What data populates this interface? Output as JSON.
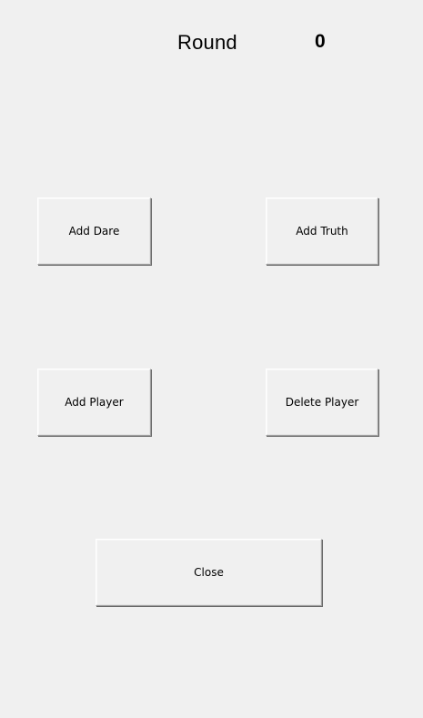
{
  "round": {
    "label": "Round",
    "value": "0"
  },
  "buttons": {
    "add_dare": "Add Dare",
    "add_truth": "Add Truth",
    "add_player": "Add Player",
    "delete_player": "Delete Player",
    "close": "Close"
  }
}
